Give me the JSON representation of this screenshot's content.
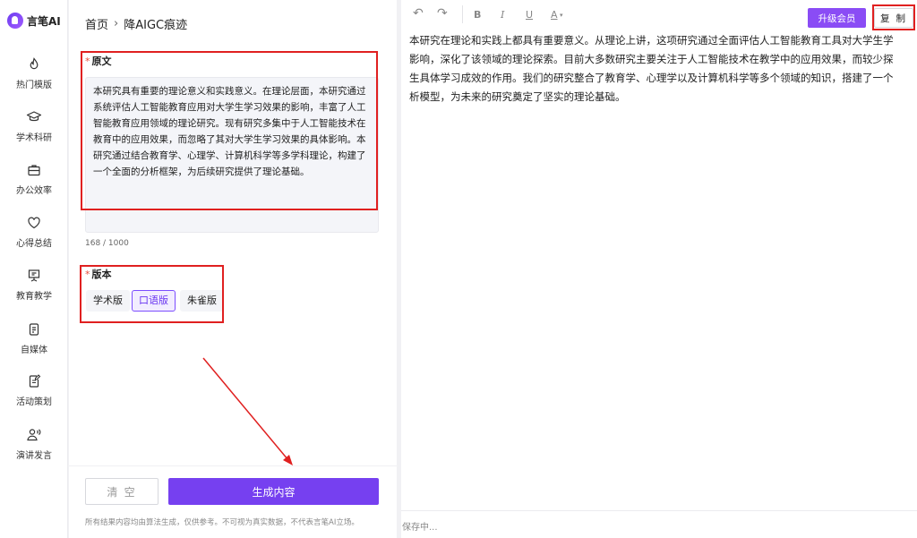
{
  "brand": {
    "name": "言笔AI"
  },
  "sidebar": {
    "items": [
      {
        "label": "热门模版",
        "icon": "flame-icon"
      },
      {
        "label": "学术科研",
        "icon": "graduation-cap-icon"
      },
      {
        "label": "办公效率",
        "icon": "briefcase-icon"
      },
      {
        "label": "心得总结",
        "icon": "heart-icon"
      },
      {
        "label": "教育教学",
        "icon": "presentation-board-icon"
      },
      {
        "label": "自媒体",
        "icon": "document-icon"
      },
      {
        "label": "活动策划",
        "icon": "edit-document-icon"
      },
      {
        "label": "演讲发言",
        "icon": "speaker-person-icon"
      }
    ]
  },
  "breadcrumb": {
    "home": "首页",
    "separator": "›",
    "current": "降AIGC痕迹"
  },
  "form": {
    "source_label": "原文",
    "required_mark": "*",
    "source_text": "本研究具有重要的理论意义和实践意义。在理论层面，本研究通过系统评估人工智能教育应用对大学生学习效果的影响，丰富了人工智能教育应用领域的理论研究。现有研究多集中于人工智能技术在教育中的应用效果，而忽略了其对大学生学习效果的具体影响。本研究通过结合教育学、心理学、计算机科学等多学科理论，构建了一个全面的分析框架，为后续研究提供了理论基础。",
    "char_count": "168 / 1000",
    "version_label": "版本",
    "versions": [
      {
        "label": "学术版",
        "selected": false
      },
      {
        "label": "口语版",
        "selected": true
      },
      {
        "label": "朱雀版",
        "selected": false
      }
    ]
  },
  "actions": {
    "clear_label": "清 空",
    "generate_label": "生成内容"
  },
  "disclaimer": "所有结果内容均由算法生成，仅供参考。不可视为真实数据，不代表言笔AI立场。",
  "editor": {
    "toolbar": {
      "undo_icon": "undo-icon",
      "redo_icon": "redo-icon",
      "bold": "B",
      "italic": "I",
      "underline": "U",
      "font_color": "A"
    },
    "upgrade_label": "升级会员",
    "copy_label": "复 制",
    "output_text": "本研究在理论和实践上都具有重要意义。从理论上讲，这项研究通过全面评估人工智能教育工具对大学生学\n影响，深化了该领域的理论探索。目前大多数研究主要关注于人工智能技术在教学中的应用效果，而较少探\n生具体学习成效的作用。我们的研究整合了教育学、心理学以及计算机科学等多个领域的知识，搭建了一个\n析模型，为未来的研究奠定了坚实的理论基础。",
    "status": "保存中..."
  },
  "colors": {
    "accent": "#7640f0",
    "annotation": "#e02020",
    "selected_bg": "#f2edff"
  }
}
